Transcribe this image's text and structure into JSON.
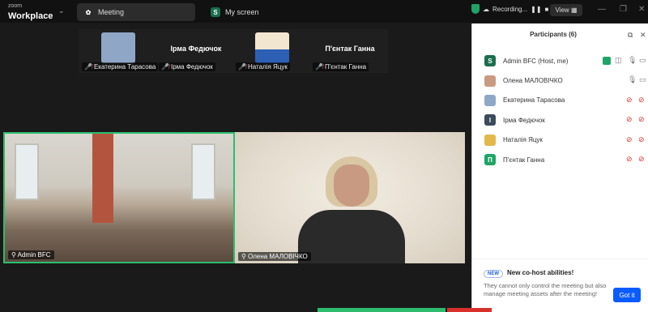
{
  "app": {
    "brand_small": "zoom",
    "brand_main": "Workplace"
  },
  "tabs": [
    {
      "label": "Meeting",
      "icon": "paw-icon"
    },
    {
      "label": "My screen",
      "icon": "S"
    }
  ],
  "recording": {
    "label": "Recording...",
    "view": "View"
  },
  "thumbnails": [
    {
      "name": "",
      "tag": "Екатерина Тарасова",
      "color": "#8fa6c7"
    },
    {
      "name": "Ірма Федючок",
      "tag": "Ірма Федючок",
      "color": ""
    },
    {
      "name": "",
      "tag": "Наталія Яцук",
      "color": "#ffd84a"
    },
    {
      "name": "П'єнтак Ганна",
      "tag": "П'єнтак Ганна",
      "color": ""
    }
  ],
  "videos": [
    {
      "tag": "Admin BFC"
    },
    {
      "tag": "Олена МАЛОВІЧКО"
    }
  ],
  "participants": {
    "title": "Participants (6)",
    "list": [
      {
        "initial": "S",
        "name": "Admin BFC (Host, me)",
        "color": "#1b6e4f"
      },
      {
        "initial": "",
        "name": "Олена МАЛОВІЧКО",
        "color": "#c99a82"
      },
      {
        "initial": "",
        "name": "Екатерина Тарасова",
        "color": "#8fa6c7"
      },
      {
        "initial": "І",
        "name": "Ірма Федючок",
        "color": "#3b4b5e"
      },
      {
        "initial": "",
        "name": "Наталія Яцук",
        "color": "#e0b94a"
      },
      {
        "initial": "П",
        "name": "П'єнтак Ганна",
        "color": "#1fa463"
      }
    ]
  },
  "notice": {
    "badge": "NEW",
    "title": "New co-host abilities!",
    "body": "They cannot only control the meeting but also manage meeting assets after the meeting!",
    "button": "Got it"
  }
}
